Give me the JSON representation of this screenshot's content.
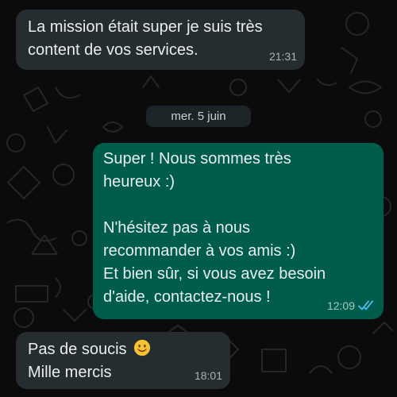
{
  "messages": [
    {
      "direction": "incoming",
      "lines": [
        "La mission était super je suis très",
        "content de vos services."
      ],
      "time": "21:31"
    },
    {
      "direction": "outgoing",
      "lines": [
        "Super ! Nous sommes très",
        "heureux :)",
        "",
        "N'hésitez pas à nous",
        "recommander à vos amis :)",
        "Et bien sûr, si vous avez besoin",
        "d'aide, contactez-nous !"
      ],
      "time": "12:09",
      "status_icon": "double-check-read-icon"
    },
    {
      "direction": "incoming",
      "lines": [
        "Pas de soucis",
        "Mille mercis"
      ],
      "emoji": "smiling-face-emoji",
      "time": "18:01"
    }
  ],
  "date_separator": "mer. 5 juin",
  "colors": {
    "background": "#0b0b0b",
    "incoming_bubble": "#262d31",
    "outgoing_bubble": "#005c4b",
    "read_tick": "#53bdeb"
  }
}
